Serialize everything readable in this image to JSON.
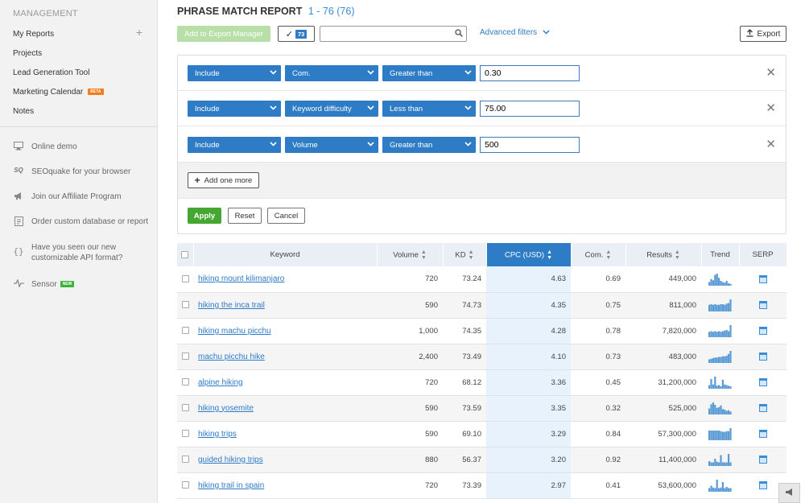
{
  "sidebar": {
    "section_title": "MANAGEMENT",
    "items": [
      {
        "label": "My Reports"
      },
      {
        "label": "Projects"
      },
      {
        "label": "Lead Generation Tool"
      },
      {
        "label": "Marketing Calendar",
        "badge": "BETA"
      },
      {
        "label": "Notes"
      }
    ],
    "links": [
      {
        "label": "Online demo",
        "icon": "monitor-icon"
      },
      {
        "label": "SEOquake for your browser",
        "icon": "seoquake-icon",
        "icon_text": "SQ"
      },
      {
        "label": "Join our Affiliate Program",
        "icon": "megaphone-icon"
      },
      {
        "label": "Order custom database or report",
        "icon": "document-icon"
      },
      {
        "label": "Have you seen our new customizable API format?",
        "icon": "curly-braces-icon",
        "icon_text": "{}"
      },
      {
        "label": "Sensor",
        "icon": "pulse-icon",
        "badge": "NEW"
      }
    ]
  },
  "report": {
    "title": "PHRASE MATCH REPORT",
    "range": "1 - 76 (76)"
  },
  "toolbar": {
    "add_to_export_manager": "Add to Export Manager",
    "selected_count": "73",
    "search_placeholder": "",
    "advanced_filters": "Advanced filters",
    "export": "Export"
  },
  "filters": [
    {
      "mode": "Include",
      "field": "Com.",
      "operator": "Greater than",
      "value": "0.30"
    },
    {
      "mode": "Include",
      "field": "Keyword difficulty",
      "operator": "Less than",
      "value": "75.00"
    },
    {
      "mode": "Include",
      "field": "Volume",
      "operator": "Greater than",
      "value": "500"
    }
  ],
  "filter_actions": {
    "add_one_more": "Add one more",
    "apply": "Apply",
    "reset": "Reset",
    "cancel": "Cancel"
  },
  "table": {
    "columns": [
      "Keyword",
      "Volume",
      "KD",
      "CPC (USD)",
      "Com.",
      "Results",
      "Trend",
      "SERP"
    ],
    "active_sort_column": "CPC (USD)",
    "rows": [
      {
        "keyword": "hiking mount kilimanjaro",
        "volume": "720",
        "kd": "73.24",
        "cpc": "4.63",
        "com": "0.69",
        "results": "449,000",
        "trend": [
          0.3,
          0.55,
          0.45,
          0.9,
          1.0,
          0.65,
          0.4,
          0.3,
          0.25,
          0.4,
          0.2,
          0.15
        ]
      },
      {
        "keyword": "hiking the inca trail",
        "volume": "590",
        "kd": "74.73",
        "cpc": "4.35",
        "com": "0.75",
        "results": "811,000",
        "trend": [
          0.55,
          0.6,
          0.55,
          0.6,
          0.55,
          0.55,
          0.6,
          0.6,
          0.55,
          0.65,
          0.7,
          1.0
        ]
      },
      {
        "keyword": "hiking machu picchu",
        "volume": "1,000",
        "kd": "74.35",
        "cpc": "4.28",
        "com": "0.78",
        "results": "7,820,000",
        "trend": [
          0.45,
          0.5,
          0.45,
          0.5,
          0.45,
          0.5,
          0.45,
          0.5,
          0.55,
          0.6,
          0.5,
          1.0
        ]
      },
      {
        "keyword": "machu picchu hike",
        "volume": "2,400",
        "kd": "73.49",
        "cpc": "4.10",
        "com": "0.73",
        "results": "483,000",
        "trend": [
          0.3,
          0.35,
          0.4,
          0.45,
          0.45,
          0.5,
          0.5,
          0.55,
          0.55,
          0.6,
          0.75,
          1.0
        ]
      },
      {
        "keyword": "alpine hiking",
        "volume": "720",
        "kd": "68.12",
        "cpc": "3.36",
        "com": "0.45",
        "results": "31,200,000",
        "trend": [
          0.3,
          0.8,
          0.35,
          1.0,
          0.25,
          0.3,
          0.2,
          0.75,
          0.35,
          0.3,
          0.25,
          0.2
        ]
      },
      {
        "keyword": "hiking yosemite",
        "volume": "590",
        "kd": "73.59",
        "cpc": "3.35",
        "com": "0.32",
        "results": "525,000",
        "trend": [
          0.5,
          0.85,
          1.0,
          0.8,
          0.55,
          0.6,
          0.75,
          0.45,
          0.4,
          0.3,
          0.35,
          0.25
        ]
      },
      {
        "keyword": "hiking trips",
        "volume": "590",
        "kd": "69.10",
        "cpc": "3.29",
        "com": "0.84",
        "results": "57,300,000",
        "trend": [
          0.8,
          0.8,
          0.8,
          0.8,
          0.8,
          0.8,
          0.75,
          0.7,
          0.7,
          0.75,
          0.75,
          1.0
        ]
      },
      {
        "keyword": "guided hiking trips",
        "volume": "880",
        "kd": "56.37",
        "cpc": "3.20",
        "com": "0.92",
        "results": "11,400,000",
        "trend": [
          0.4,
          0.3,
          0.3,
          0.6,
          0.35,
          0.3,
          0.9,
          0.3,
          0.3,
          0.3,
          1.0,
          0.3
        ]
      },
      {
        "keyword": "hiking trail in spain",
        "volume": "720",
        "kd": "73.39",
        "cpc": "2.97",
        "com": "0.41",
        "results": "53,600,000",
        "trend": [
          0.3,
          0.5,
          0.35,
          0.3,
          1.0,
          0.3,
          0.35,
          0.8,
          0.3,
          0.4,
          0.3,
          0.3
        ]
      }
    ]
  },
  "colors": {
    "accent": "#2e7cc6",
    "apply_green": "#45a632",
    "export_manager_disabled": "#b8dfa8",
    "trend_bar": "#5b9bd5"
  }
}
